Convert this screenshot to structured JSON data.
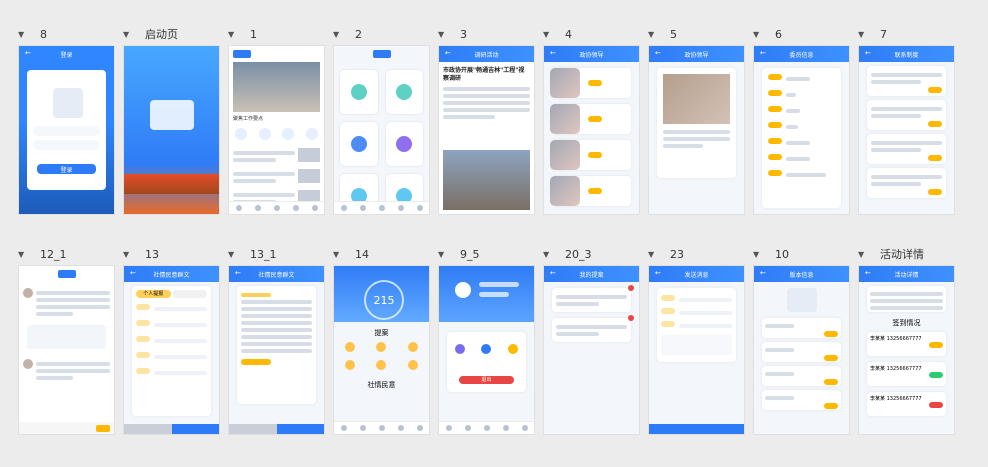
{
  "groups": [
    {
      "label": "8"
    },
    {
      "label": "启动页"
    },
    {
      "label": "1"
    },
    {
      "label": "2"
    },
    {
      "label": "3"
    },
    {
      "label": "4"
    },
    {
      "label": "5"
    },
    {
      "label": "6"
    },
    {
      "label": "7"
    },
    {
      "label": "12_1"
    },
    {
      "label": "13"
    },
    {
      "label": "13_1"
    },
    {
      "label": "14"
    },
    {
      "label": "9_5"
    },
    {
      "label": "20_3"
    },
    {
      "label": "23"
    },
    {
      "label": "10"
    },
    {
      "label": "活动详情"
    }
  ],
  "screens": {
    "login": {
      "title": "登录",
      "button": "登录"
    },
    "home1": {
      "headline": "聚焦工作要点"
    },
    "article3": {
      "title": "调研活动",
      "headline": "市政协开展\"畅通吉林\"工程\"视察调研"
    },
    "leaders4": {
      "title": "政协领导"
    },
    "work5": {
      "title": "政协领导"
    },
    "member6": {
      "title": "委员信息"
    },
    "system7": {
      "title": "联系制度"
    },
    "social13": {
      "title": "社情民意群文",
      "tab1": "个人提报"
    },
    "social13_1": {
      "title": "社情民意群文"
    },
    "stats14": {
      "number": "215",
      "section1": "提案",
      "section2": "社情民意"
    },
    "profile9_5": {
      "logout": "退出"
    },
    "myproposal20_3": {
      "title": "我的提案"
    },
    "send23": {
      "title": "发送消息"
    },
    "version10": {
      "title": "版本信息"
    },
    "activity": {
      "title": "活动详情",
      "section": "签到情况",
      "phone": "13256667777",
      "name": "李某某"
    }
  }
}
